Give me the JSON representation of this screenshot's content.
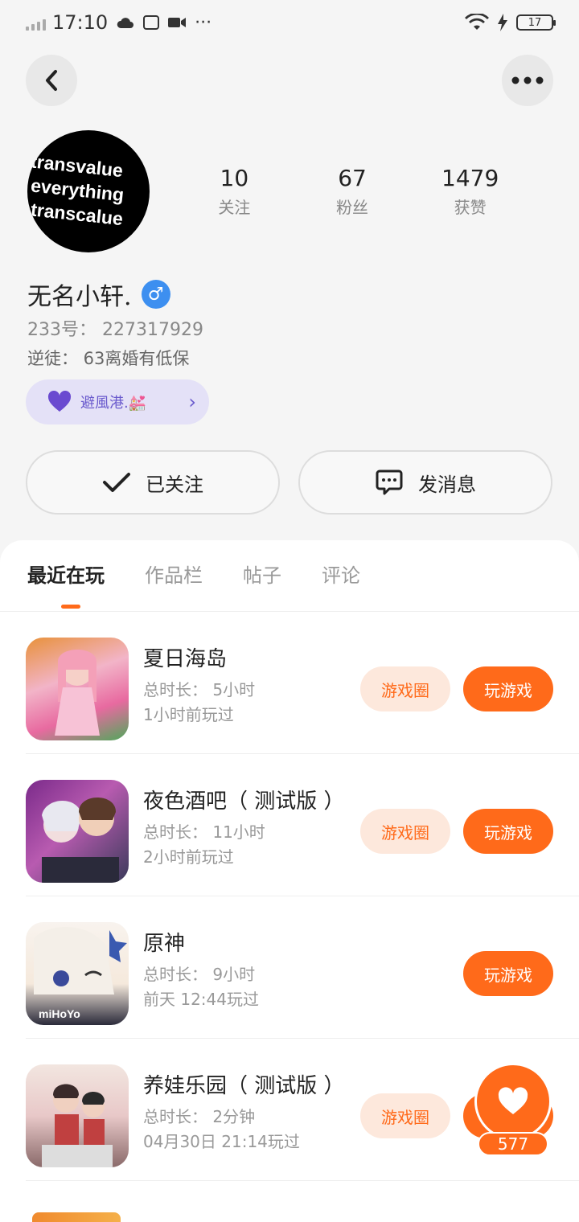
{
  "status_bar": {
    "time": "17:10",
    "battery": "17",
    "dots": "···"
  },
  "nav": {
    "back_icon": "back-arrow-icon",
    "more_icon": "more-dots-icon"
  },
  "profile": {
    "avatar_lines": [
      "transvalue",
      "everything",
      "transcalue"
    ],
    "stats": [
      {
        "num": "10",
        "label": "关注"
      },
      {
        "num": "67",
        "label": "粉丝"
      },
      {
        "num": "1479",
        "label": "获赞"
      }
    ],
    "username": "无名小轩.",
    "gender_symbol": "♂",
    "uid": "233号：  227317929",
    "bio": "逆徒：  63离婚有低保",
    "club_name": "避風港.💒",
    "follow_label": "已关注",
    "message_label": "发消息"
  },
  "tabs": [
    "最近在玩",
    "作品栏",
    "帖子",
    "评论"
  ],
  "games": [
    {
      "name": "夏日海岛",
      "duration": "总时长：  5小时",
      "last": "1小时前玩过",
      "circle": "游戏圈",
      "play": "玩游戏"
    },
    {
      "name": "夜色酒吧（ 测试版 ）",
      "duration": "总时长：  11小时",
      "last": "2小时前玩过",
      "circle": "游戏圈",
      "play": "玩游戏"
    },
    {
      "name": "原神",
      "duration": "总时长：  9小时",
      "last": "前天 12:44玩过",
      "circle": "",
      "play": "玩游戏",
      "icon_text": "miHoYo"
    },
    {
      "name": "养娃乐园（ 测试版 ）",
      "duration": "总时长：  2分钟",
      "last": "04月30日  21:14玩过",
      "circle": "游戏圈",
      "play": "玩游戏"
    }
  ],
  "like": {
    "count": "577"
  },
  "colors": {
    "accent": "#ff6a1a",
    "gender": "#3d8ff0",
    "club_bg": "#e4e1f7"
  }
}
